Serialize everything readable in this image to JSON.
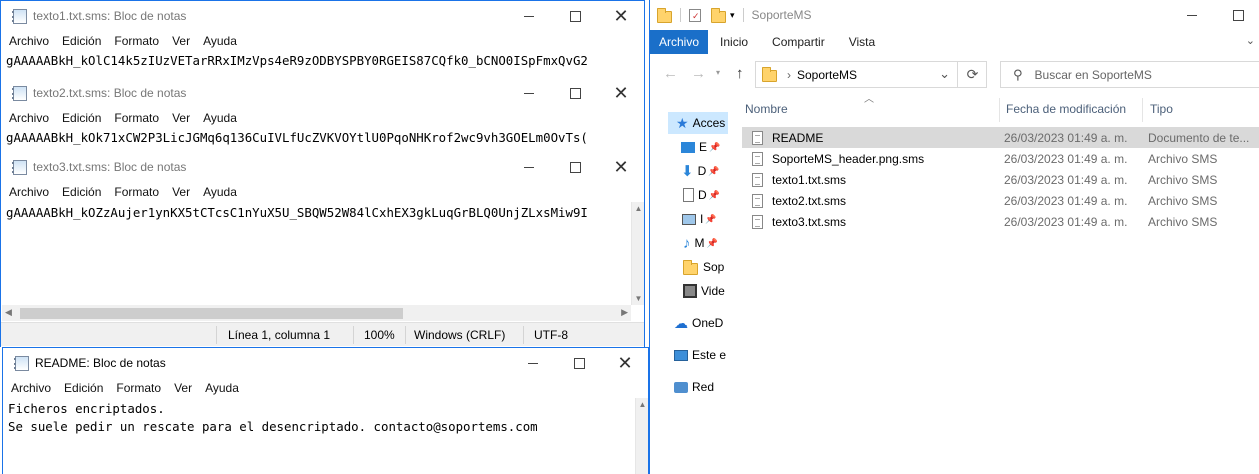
{
  "notepad1": {
    "title": "texto1.txt.sms: Bloc de notas",
    "content": "gAAAAABkH_kOlC14k5zIUzVETarRRxIMzVps4eR9zODBYSPBY0RGEIS87CQfk0_bCNO0ISpFmxQvG2"
  },
  "notepad2": {
    "title": "texto2.txt.sms: Bloc de notas",
    "content": "gAAAAABkH_kOk71xCW2P3LicJGMq6q136CuIVLfUcZVKVOYtlU0PqoNHKrof2wc9vh3GOELm0OvTs("
  },
  "notepad3": {
    "title": "texto3.txt.sms: Bloc de notas",
    "content": "gAAAAABkH_kOZzAujer1ynKX5tCTcsC1nYuX5U_SBQW52W84lCxhEX3gkLuqGrBLQ0UnjZLxsMiw9I",
    "status": {
      "position": "Línea 1, columna 1",
      "zoom": "100%",
      "eol": "Windows (CRLF)",
      "encoding": "UTF-8"
    }
  },
  "readme": {
    "title": "README: Bloc de notas",
    "content": "Ficheros encriptados.\nSe suele pedir un rescate para el desencriptado. contacto@soportems.com"
  },
  "menu": [
    "Archivo",
    "Edición",
    "Formato",
    "Ver",
    "Ayuda"
  ],
  "explorer": {
    "title": "SoporteMS",
    "tabs": [
      "Archivo",
      "Inicio",
      "Compartir",
      "Vista"
    ],
    "address": "SoporteMS",
    "search_placeholder": "Buscar en SoporteMS",
    "nav": [
      "Acces",
      "E",
      "D",
      "D",
      "I",
      "M",
      "Sop",
      "Vide",
      "OneD",
      "Este e",
      "Red"
    ],
    "columns": {
      "name": "Nombre",
      "date": "Fecha de modificación",
      "type": "Tipo"
    },
    "files": [
      {
        "name": "README",
        "date": "26/03/2023 01:49 a. m.",
        "type": "Documento de te..."
      },
      {
        "name": "SoporteMS_header.png.sms",
        "date": "26/03/2023 01:49 a. m.",
        "type": "Archivo SMS"
      },
      {
        "name": "texto1.txt.sms",
        "date": "26/03/2023 01:49 a. m.",
        "type": "Archivo SMS"
      },
      {
        "name": "texto2.txt.sms",
        "date": "26/03/2023 01:49 a. m.",
        "type": "Archivo SMS"
      },
      {
        "name": "texto3.txt.sms",
        "date": "26/03/2023 01:49 a. m.",
        "type": "Archivo SMS"
      }
    ]
  },
  "colors": {
    "accent": "#1a6fc9",
    "selection": "#cce8ff",
    "row_selected": "#d9d9d9"
  }
}
